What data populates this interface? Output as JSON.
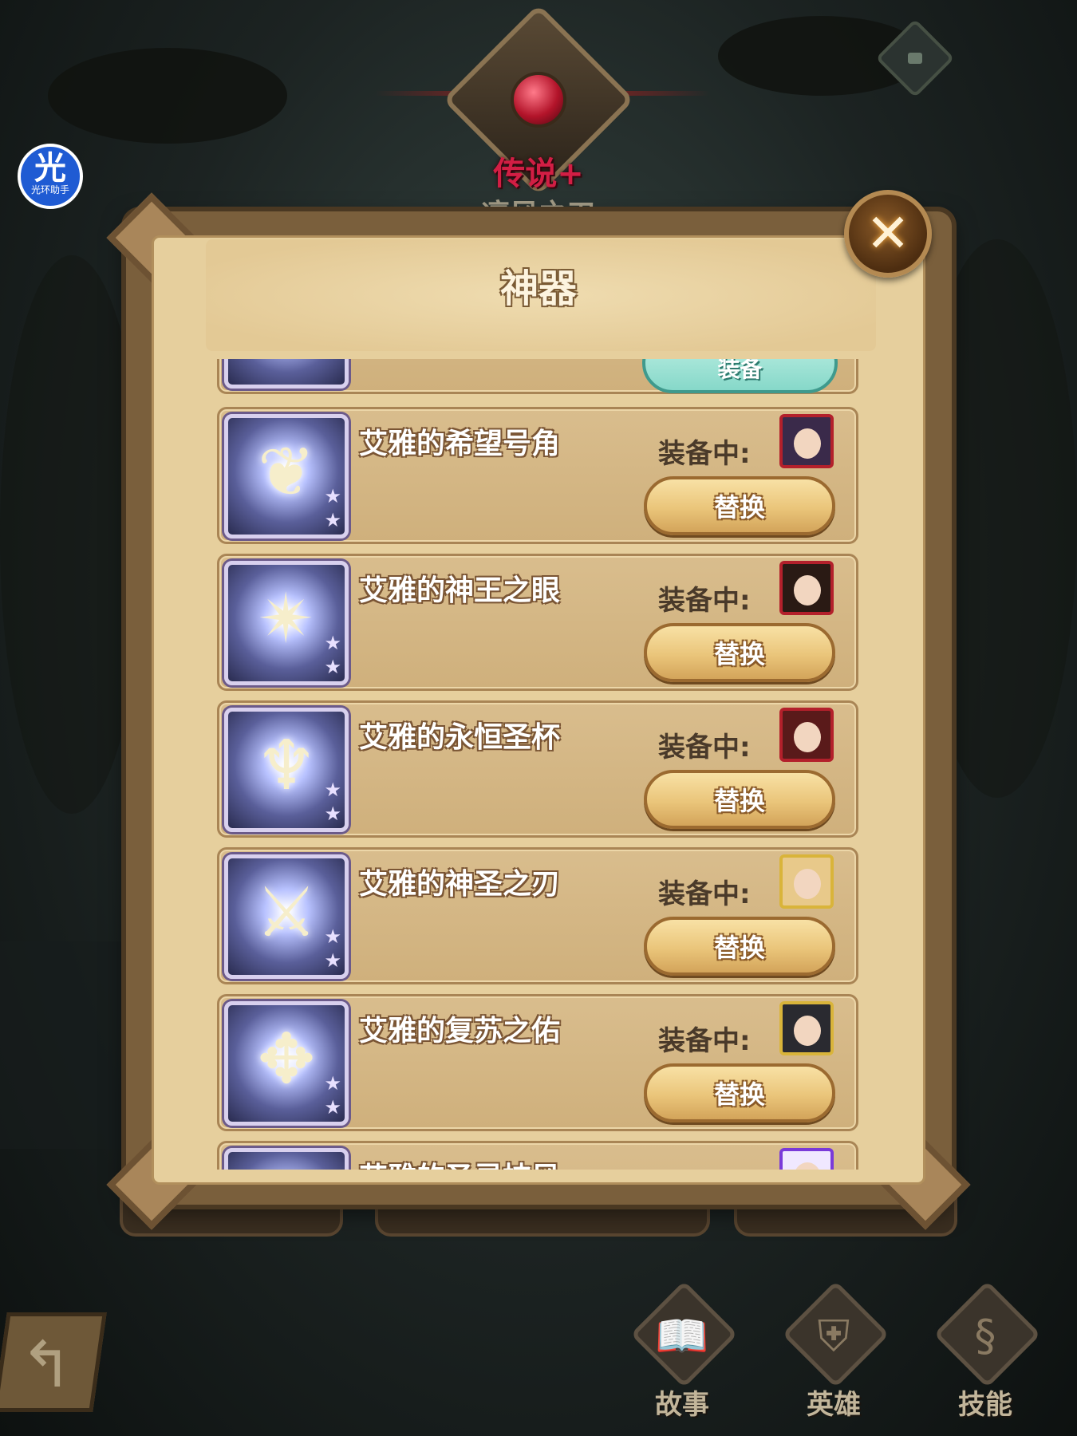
{
  "header": {
    "rarity": "传说+",
    "hero_name_partial": "凛风之刃"
  },
  "watermark": {
    "glyph": "光",
    "text": "光环助手"
  },
  "dialog": {
    "title": "神器",
    "close_glyph": "✕"
  },
  "list": {
    "partial_top_button": "装备",
    "equipped_label": "装备中:",
    "replace_label": "替换",
    "items": [
      {
        "name": "艾雅的希望号角",
        "icon": "horn-icon",
        "glyph": "❦",
        "portrait_border": "#b3202b",
        "portrait_bg": "#3a2a4a"
      },
      {
        "name": "艾雅的神王之眼",
        "icon": "eye-icon",
        "glyph": "✴",
        "portrait_border": "#b3202b",
        "portrait_bg": "#2a1a14"
      },
      {
        "name": "艾雅的永恒圣杯",
        "icon": "chalice-icon",
        "glyph": "♆",
        "portrait_border": "#b3202b",
        "portrait_bg": "#5a1a1a"
      },
      {
        "name": "艾雅的神圣之刃",
        "icon": "sword-icon",
        "glyph": "⚔",
        "portrait_border": "#d9b43a",
        "portrait_bg": "#e8c98a"
      },
      {
        "name": "艾雅的复苏之佑",
        "icon": "amulet-icon",
        "glyph": "✥",
        "portrait_border": "#d9b43a",
        "portrait_bg": "#2a2a30"
      },
      {
        "name": "艾雅的圣灵披风",
        "icon": "cloak-icon",
        "glyph": "✧",
        "portrait_border": "#7a3ad9",
        "portrait_bg": "#f0e8ff"
      }
    ]
  },
  "nav": {
    "story_label": "故事",
    "story_glyph": "📖",
    "heroes_label": "英雄",
    "heroes_glyph": "⛨",
    "skills_label": "技能",
    "skills_glyph": "§",
    "back_glyph": "↰"
  },
  "colors": {
    "rarity": "#d21e44",
    "panel": "#e6cf9d",
    "button": "#eac57a"
  }
}
